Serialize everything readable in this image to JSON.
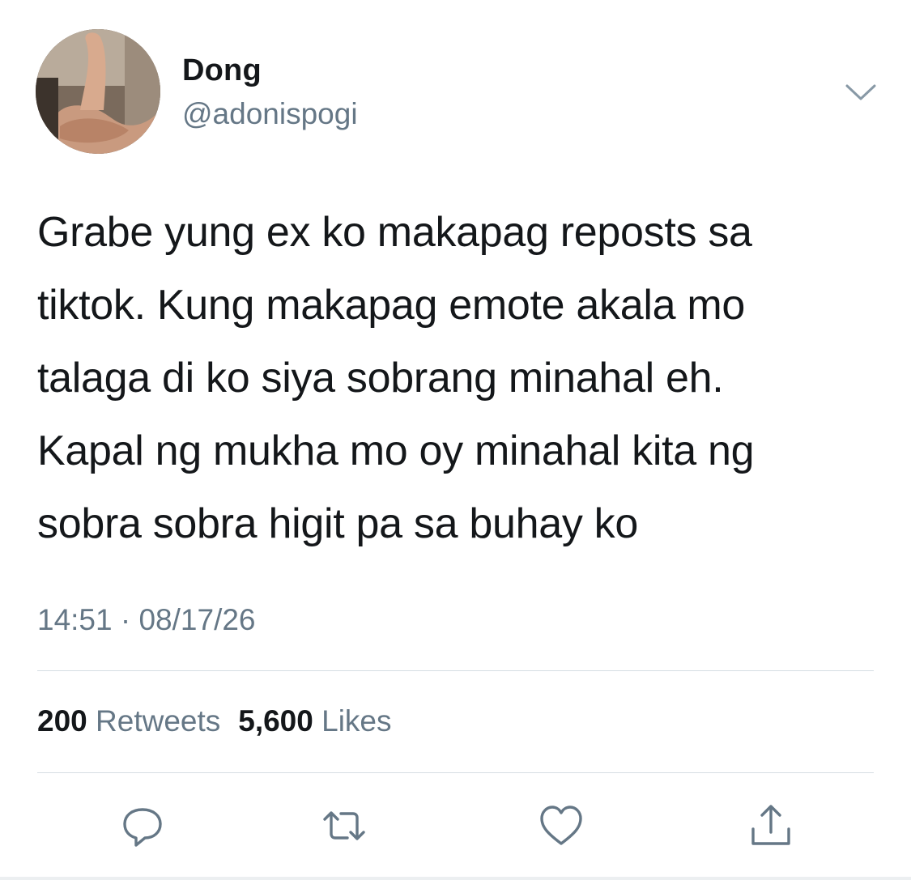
{
  "user": {
    "display_name": "Dong",
    "handle": "@adonispogi",
    "avatar_icon": "avatar-photo"
  },
  "tweet": {
    "text": "Grabe yung ex ko makapag reposts sa\ntiktok. Kung makapag emote akala mo\ntalaga di ko siya sobrang minahal eh.\nKapal ng mukha mo oy minahal kita ng\nsobra sobra higit pa sa buhay ko",
    "time": "14:51",
    "separator": "·",
    "date": "08/17/26"
  },
  "stats": {
    "retweets_count": "200",
    "retweets_label": "Retweets",
    "likes_count": "5,600",
    "likes_label": "Likes"
  },
  "actions": {
    "reply_icon": "reply-icon",
    "retweet_icon": "retweet-icon",
    "like_icon": "heart-icon",
    "share_icon": "share-icon"
  },
  "colors": {
    "text_primary": "#14171a",
    "text_secondary": "#657786",
    "divider": "#d6dde3"
  }
}
